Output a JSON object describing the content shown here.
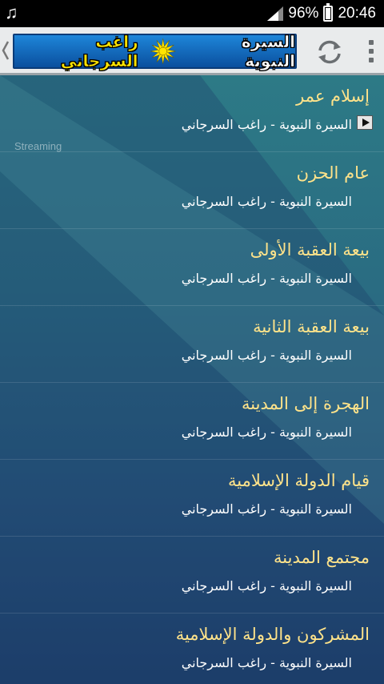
{
  "status_bar": {
    "battery": "96%",
    "time": "20:46",
    "music_icon": "music-note-icon"
  },
  "app_bar": {
    "title_part1": "السيرة النبوية",
    "title_part2": "راغب السرجاني",
    "icons": [
      "back-chevron-icon",
      "sun-emblem-icon",
      "refresh-icon",
      "overflow-menu-icon"
    ]
  },
  "list": {
    "streaming_label": "Streaming",
    "items": [
      {
        "title": "إسلام عمر",
        "subtitle": "السيرة النبوية - راغب السرجاني"
      },
      {
        "title": "عام الحزن",
        "subtitle": "السيرة النبوية - راغب السرجاني"
      },
      {
        "title": "بيعة العقبة الأولى",
        "subtitle": "السيرة النبوية - راغب السرجاني"
      },
      {
        "title": "بيعة العقبة الثانية",
        "subtitle": "السيرة النبوية - راغب السرجاني"
      },
      {
        "title": "الهجرة إلى المدينة",
        "subtitle": "السيرة النبوية - راغب السرجاني"
      },
      {
        "title": "قيام الدولة الإسلامية",
        "subtitle": "السيرة النبوية - راغب السرجاني"
      },
      {
        "title": "مجتمع المدينة",
        "subtitle": "السيرة النبوية - راغب السرجاني"
      },
      {
        "title": "المشركون والدولة الإسلامية",
        "subtitle": "السيرة النبوية - راغب السرجاني"
      }
    ]
  },
  "colors": {
    "title_yellow": "#ffe400",
    "item_title": "#ffe38a",
    "banner_blue": "#1e86d9"
  }
}
